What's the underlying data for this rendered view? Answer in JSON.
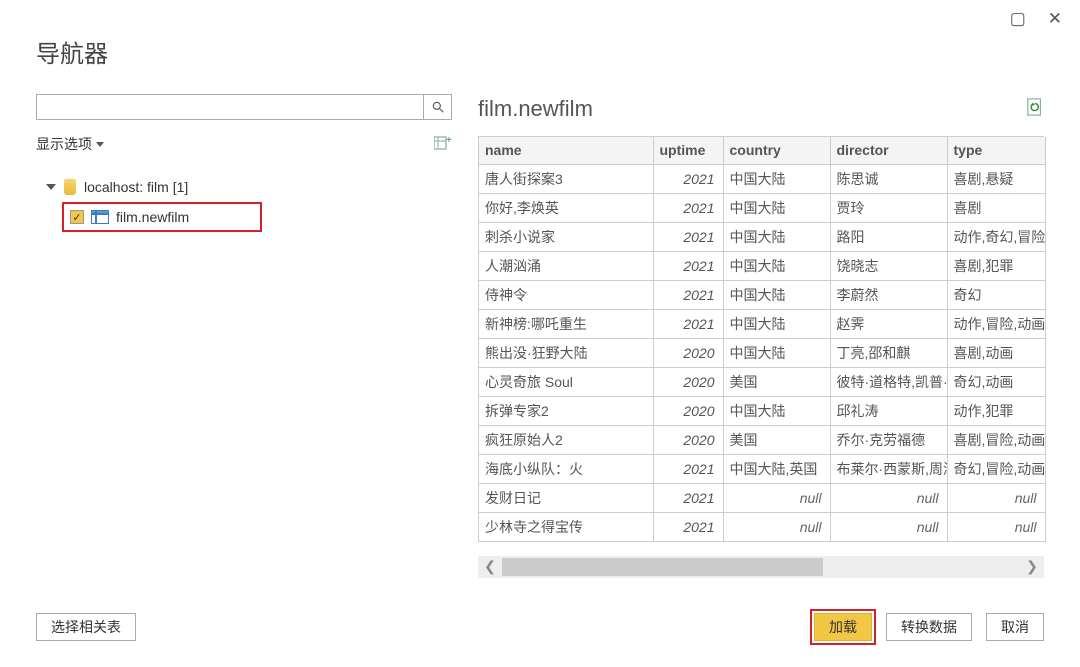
{
  "window": {
    "title": "导航器"
  },
  "left": {
    "display_options": "显示选项",
    "db_label": "localhost: film [1]",
    "child_label": "film.newfilm"
  },
  "preview": {
    "title": "film.newfilm",
    "columns": [
      "name",
      "uptime",
      "country",
      "director",
      "type"
    ],
    "rows": [
      {
        "name": "唐人街探案3",
        "uptime": "2021",
        "country": "中国大陆",
        "director": "陈思诚",
        "type": "喜剧,悬疑"
      },
      {
        "name": "你好,李焕英",
        "uptime": "2021",
        "country": "中国大陆",
        "director": "贾玲",
        "type": "喜剧"
      },
      {
        "name": "刺杀小说家",
        "uptime": "2021",
        "country": "中国大陆",
        "director": "路阳",
        "type": "动作,奇幻,冒险"
      },
      {
        "name": "人潮汹涌",
        "uptime": "2021",
        "country": "中国大陆",
        "director": "饶晓志",
        "type": "喜剧,犯罪"
      },
      {
        "name": "侍神令",
        "uptime": "2021",
        "country": "中国大陆",
        "director": "李蔚然",
        "type": "奇幻"
      },
      {
        "name": "新神榜:哪吒重生",
        "uptime": "2021",
        "country": "中国大陆",
        "director": "赵霁",
        "type": "动作,冒险,动画"
      },
      {
        "name": "熊出没·狂野大陆",
        "uptime": "2020",
        "country": "中国大陆",
        "director": "丁亮,邵和麒",
        "type": "喜剧,动画"
      },
      {
        "name": "心灵奇旅 Soul",
        "uptime": "2020",
        "country": "美国",
        "director": "彼特·道格特,凯普·鲍",
        "type": "奇幻,动画"
      },
      {
        "name": "拆弹专家2",
        "uptime": "2020",
        "country": "中国大陆",
        "director": "邱礼涛",
        "type": "动作,犯罪"
      },
      {
        "name": "疯狂原始人2",
        "uptime": "2020",
        "country": "美国",
        "director": "乔尔·克劳福德",
        "type": "喜剧,冒险,动画"
      },
      {
        "name": "海底小纵队：火",
        "uptime": "2021",
        "country": "中国大陆,英国",
        "director": "布莱尔·西蒙斯,周沁",
        "type": "奇幻,冒险,动画"
      },
      {
        "name": "发财日记",
        "uptime": "2021",
        "country": "null",
        "director": "null",
        "type": "null"
      },
      {
        "name": "少林寺之得宝传",
        "uptime": "2021",
        "country": "null",
        "director": "null",
        "type": "null"
      }
    ]
  },
  "footer": {
    "select_related": "选择相关表",
    "load": "加载",
    "transform": "转换数据",
    "cancel": "取消"
  }
}
